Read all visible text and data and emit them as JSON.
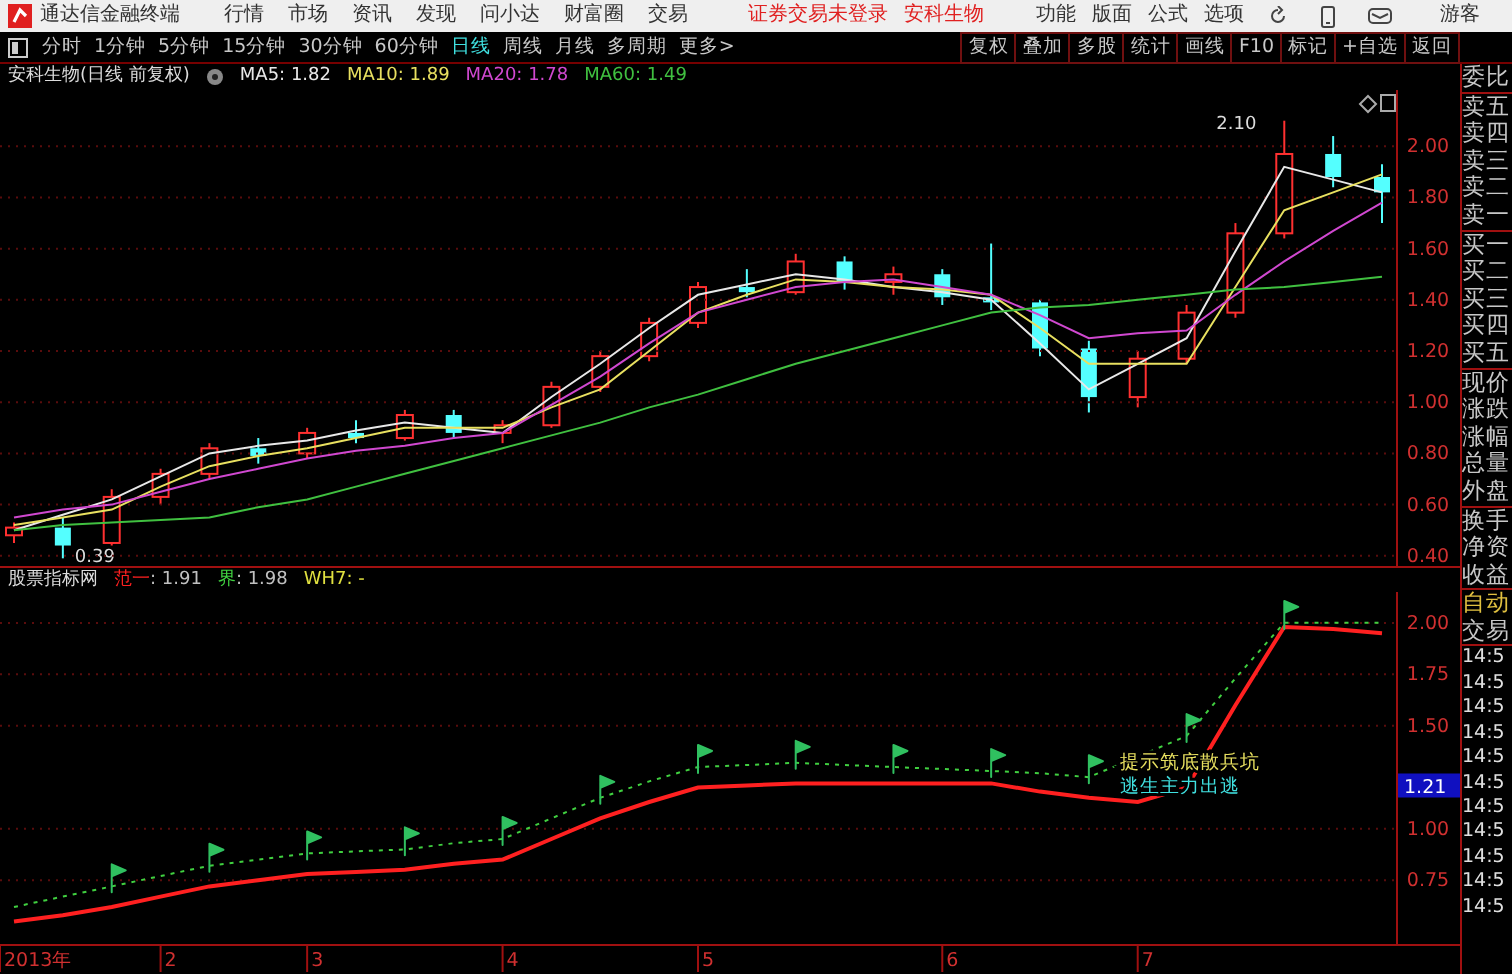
{
  "app": {
    "title": "通达信金融终端"
  },
  "menu": [
    "行情",
    "市场",
    "资讯",
    "发现",
    "问小达",
    "财富圈",
    "交易"
  ],
  "status_texts": [
    "证券交易未登录",
    "安科生物"
  ],
  "top_actions": [
    "功能",
    "版面",
    "公式",
    "选项"
  ],
  "user": "游客",
  "periods": [
    {
      "label": "分时",
      "selected": false
    },
    {
      "label": "1分钟",
      "selected": false
    },
    {
      "label": "5分钟",
      "selected": false
    },
    {
      "label": "15分钟",
      "selected": false
    },
    {
      "label": "30分钟",
      "selected": false
    },
    {
      "label": "60分钟",
      "selected": false
    },
    {
      "label": "日线",
      "selected": true
    },
    {
      "label": "周线",
      "selected": false
    },
    {
      "label": "月线",
      "selected": false
    },
    {
      "label": "多周期",
      "selected": false
    },
    {
      "label": "更多>",
      "selected": false
    }
  ],
  "tools": [
    "复权",
    "叠加",
    "多股",
    "统计",
    "画线",
    "F10",
    "标记",
    "+自选",
    "返回"
  ],
  "main_chart": {
    "title": "安科生物(日线 前复权)",
    "legend": [
      {
        "value": ": 1.82"
      },
      {
        "value": ": 1.89"
      },
      {
        "value": ": 1.78"
      },
      {
        "value": ": 1.49"
      }
    ],
    "chart_data": {
      "type": "candlestick",
      "categories": [
        null,
        null,
        null,
        null,
        null,
        null,
        null,
        null,
        null,
        null,
        null,
        null,
        null,
        null,
        null,
        null,
        null,
        null,
        null,
        null,
        null,
        null,
        null,
        null,
        null,
        null,
        null,
        null,
        null
      ],
      "ylim": [
        0.36,
        2.22
      ],
      "ohlc": [
        [
          0.48,
          0.53,
          0.45,
          0.51
        ],
        [
          0.51,
          0.55,
          0.39,
          0.44
        ],
        [
          0.45,
          0.66,
          0.44,
          0.63
        ],
        [
          0.63,
          0.74,
          0.6,
          0.72
        ],
        [
          0.72,
          0.84,
          0.7,
          0.82
        ],
        [
          0.82,
          0.86,
          0.76,
          0.79
        ],
        [
          0.8,
          0.9,
          0.78,
          0.88
        ],
        [
          0.88,
          0.93,
          0.84,
          0.86
        ],
        [
          0.86,
          0.97,
          0.85,
          0.95
        ],
        [
          0.95,
          0.97,
          0.86,
          0.88
        ],
        [
          0.88,
          0.93,
          0.84,
          0.91
        ],
        [
          0.91,
          1.08,
          0.9,
          1.06
        ],
        [
          1.06,
          1.2,
          1.04,
          1.18
        ],
        [
          1.18,
          1.33,
          1.16,
          1.31
        ],
        [
          1.31,
          1.47,
          1.29,
          1.45
        ],
        [
          1.45,
          1.52,
          1.41,
          1.43
        ],
        [
          1.43,
          1.58,
          1.42,
          1.55
        ],
        [
          1.55,
          1.57,
          1.44,
          1.47
        ],
        [
          1.47,
          1.53,
          1.42,
          1.5
        ],
        [
          1.5,
          1.52,
          1.38,
          1.41
        ],
        [
          1.41,
          1.62,
          1.36,
          1.39
        ],
        [
          1.39,
          1.4,
          1.18,
          1.21
        ],
        [
          1.21,
          1.24,
          0.96,
          1.02
        ],
        [
          1.02,
          1.2,
          0.98,
          1.17
        ],
        [
          1.17,
          1.38,
          1.15,
          1.35
        ],
        [
          1.35,
          1.7,
          1.33,
          1.66
        ],
        [
          1.66,
          2.1,
          1.64,
          1.97
        ],
        [
          1.97,
          2.04,
          1.84,
          1.88
        ],
        [
          1.88,
          1.93,
          1.7,
          1.82
        ]
      ],
      "annotations": [
        "2.10",
        "0.39"
      ]
    },
    "moving_averages": {
      "chart_data": {
        "type": "line",
        "grid": true,
        "categories": [
          null,
          null,
          null,
          null,
          null,
          null,
          null,
          null,
          null,
          null,
          null,
          null,
          null,
          null,
          null,
          null,
          null,
          null,
          null,
          null,
          null,
          null,
          null,
          null,
          null,
          null,
          null,
          null,
          null
        ],
        "ylim": [
          0.36,
          2.22
        ],
        "yticks": [
          {
            "value": 0.4,
            "label": "0.40"
          },
          {
            "value": 0.6,
            "label": "0.60"
          },
          {
            "value": 0.8,
            "label": "0.80"
          },
          {
            "value": 1.0,
            "label": "1.00"
          },
          {
            "value": 1.2,
            "label": "1.20"
          },
          {
            "value": 1.4,
            "label": "1.40"
          },
          {
            "value": 1.6,
            "label": "1.60"
          },
          {
            "value": 1.8,
            "label": "1.80"
          },
          {
            "value": 2.0,
            "label": "2.00"
          }
        ],
        "series": [
          {
            "name": "MA5",
            "color": "#e8e8e8",
            "values": [
              0.5,
              0.56,
              0.62,
              0.71,
              0.8,
              0.83,
              0.85,
              0.89,
              0.92,
              0.9,
              0.88,
              1.02,
              1.15,
              1.29,
              1.42,
              1.46,
              1.5,
              1.48,
              1.45,
              1.43,
              1.4,
              1.23,
              1.05,
              1.15,
              1.25,
              1.59,
              1.92,
              1.87,
              1.82
            ]
          },
          {
            "name": "MA10",
            "color": "#e8e060",
            "values": [
              0.52,
              0.55,
              0.58,
              0.67,
              0.75,
              0.79,
              0.82,
              0.86,
              0.9,
              0.9,
              0.9,
              0.98,
              1.05,
              1.2,
              1.35,
              1.42,
              1.48,
              1.47,
              1.45,
              1.44,
              1.42,
              1.29,
              1.15,
              1.15,
              1.15,
              1.45,
              1.75,
              1.82,
              1.89
            ]
          },
          {
            "name": "MA20",
            "color": "#d048d0",
            "values": [
              0.55,
              0.58,
              0.6,
              0.65,
              0.7,
              0.74,
              0.78,
              0.81,
              0.83,
              0.86,
              0.88,
              0.99,
              1.1,
              1.23,
              1.35,
              1.4,
              1.45,
              1.47,
              1.48,
              1.45,
              1.42,
              1.34,
              1.25,
              1.27,
              1.28,
              1.42,
              1.55,
              1.67,
              1.78
            ]
          },
          {
            "name": "MA60",
            "color": "#40c040",
            "values": [
              0.5,
              0.52,
              0.53,
              0.54,
              0.55,
              0.59,
              0.62,
              0.67,
              0.72,
              0.77,
              0.82,
              0.87,
              0.92,
              0.98,
              1.03,
              1.09,
              1.15,
              1.2,
              1.25,
              1.3,
              1.35,
              1.37,
              1.38,
              1.4,
              1.42,
              1.44,
              1.45,
              1.47,
              1.49
            ]
          }
        ]
      }
    }
  },
  "indicator_chart": {
    "title": "股票指标网",
    "legend": [
      {
        "value": ": 1.91"
      },
      {
        "value": ": 1.98"
      }
    ],
    "extra_legend": {
      "text": "WH7: -",
      "color": "#e0e040"
    },
    "signals": [
      {
        "text": "提示筑底散兵坑",
        "color": "#e8e060"
      },
      {
        "text": "逃生主力出逃",
        "color": "#40e0e0"
      }
    ],
    "current_value": "1.21",
    "chart_data": {
      "type": "line",
      "grid": true,
      "categories": [
        "2013年",
        null,
        null,
        "2",
        null,
        null,
        "3",
        null,
        null,
        null,
        "4",
        null,
        null,
        null,
        "5",
        null,
        null,
        null,
        null,
        "6",
        null,
        null,
        null,
        "7",
        null,
        null,
        null,
        null,
        null
      ],
      "ylim": [
        0.44,
        2.15
      ],
      "yticks": [
        {
          "value": 0.75,
          "label": "0.75"
        },
        {
          "value": 1.0,
          "label": "1.00"
        },
        {
          "value": 1.5,
          "label": "1.50"
        },
        {
          "value": 1.75,
          "label": "1.75"
        },
        {
          "value": 2.0,
          "label": "2.00"
        }
      ],
      "series": [
        {
          "name": "范一",
          "color": "#ff2020",
          "values": [
            0.55,
            0.58,
            0.62,
            0.67,
            0.72,
            0.75,
            0.78,
            0.79,
            0.8,
            0.83,
            0.85,
            0.95,
            1.05,
            1.13,
            1.2,
            1.21,
            1.22,
            1.22,
            1.22,
            1.22,
            1.22,
            1.18,
            1.15,
            1.13,
            1.2,
            1.6,
            1.98,
            1.97,
            1.95
          ]
        },
        {
          "name": "界",
          "color": "#40d040",
          "line_style": "dashed",
          "values": [
            0.62,
            0.67,
            0.72,
            0.77,
            0.82,
            0.85,
            0.88,
            0.89,
            0.9,
            0.93,
            0.95,
            1.05,
            1.15,
            1.23,
            1.3,
            1.31,
            1.32,
            1.31,
            1.3,
            1.29,
            1.28,
            1.27,
            1.25,
            1.35,
            1.45,
            1.73,
            2.0,
            2.0,
            2.0
          ]
        }
      ]
    }
  },
  "quote_panel": {
    "groups": [
      [
        "委比"
      ],
      [
        "卖五",
        "卖四",
        "卖三",
        "卖二",
        "卖一"
      ],
      [
        "买一",
        "买二",
        "买三",
        "买四",
        "买五"
      ],
      [
        "现价",
        "涨跌",
        "涨幅",
        "总量",
        "外盘"
      ],
      [
        "换手",
        "净资",
        "收益"
      ]
    ],
    "mode": "自动",
    "trade": "交易",
    "times": [
      "14:5",
      "14:5",
      "14:5",
      "14:5",
      "14:5",
      "14:5",
      "14:5",
      "14:5",
      "14:5",
      "14:5",
      "14:5"
    ]
  }
}
